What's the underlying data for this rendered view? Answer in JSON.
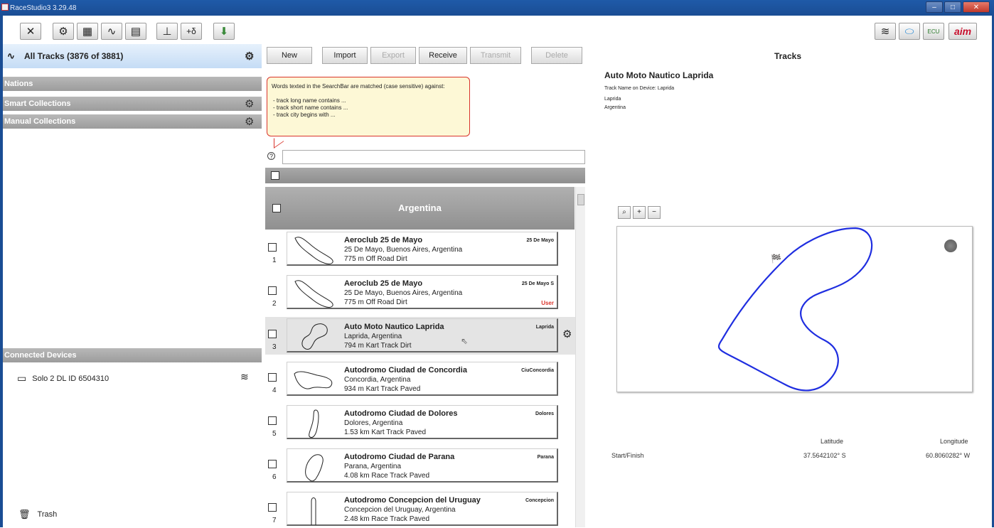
{
  "window": {
    "title": "RaceStudio3 3.29.48"
  },
  "toolbar": {
    "icons": [
      "tools-icon",
      "settings-icon",
      "dashboard-icon",
      "tracks-icon",
      "analysis-icon",
      "tuning-icon",
      "math-channels-icon",
      "download-icon"
    ],
    "right_icons": [
      "wifi-icon",
      "device-icon",
      "ecu-icon",
      "aim-logo"
    ],
    "ecu_label": "ECU",
    "logo_text": "aim"
  },
  "sidebar": {
    "all_tracks": "All Tracks  (3876 of 3881)",
    "sections": [
      "Nations",
      "Smart Collections",
      "Manual Collections"
    ],
    "connected_devices_label": "Connected Devices",
    "device": "Solo 2 DL ID 6504310",
    "trash": "Trash"
  },
  "actions": {
    "new": "New",
    "import": "Import",
    "export": "Export",
    "receive": "Receive",
    "transmit": "Transmit",
    "delete": "Delete"
  },
  "tooltip": {
    "line1": "Words texted in the SearchBar are matched (case sensitive) against:",
    "line2": "- track long name contains ...",
    "line3": "- track short name contains ...",
    "line4": "- track city begins with ..."
  },
  "search": {
    "value": "",
    "help": "?"
  },
  "list": {
    "country": "Argentina",
    "tracks": [
      {
        "num": "1",
        "name": "Aeroclub 25 de Mayo",
        "location": "25 De Mayo, Buenos Aires, Argentina",
        "type": "775 m Off Road Dirt",
        "short": "25 De Mayo",
        "user": ""
      },
      {
        "num": "2",
        "name": "Aeroclub 25 de Mayo",
        "location": "25 De Mayo, Buenos Aires, Argentina",
        "type": "775 m Off Road Dirt",
        "short": "25 De Mayo S",
        "user": "User"
      },
      {
        "num": "3",
        "name": "Auto Moto Nautico Laprida",
        "location": "Laprida, Argentina",
        "type": "794 m Kart Track Dirt",
        "short": "Laprida",
        "user": ""
      },
      {
        "num": "4",
        "name": "Autodromo Ciudad de Concordia",
        "location": "Concordia, Argentina",
        "type": "934 m Kart Track Paved",
        "short": "CiuConcordia",
        "user": ""
      },
      {
        "num": "5",
        "name": "Autodromo Ciudad de Dolores",
        "location": "Dolores, Argentina",
        "type": "1.53 km Kart Track Paved",
        "short": "Dolores",
        "user": ""
      },
      {
        "num": "6",
        "name": "Autodromo Ciudad de Parana",
        "location": "Parana, Argentina",
        "type": "4.08 km Race Track Paved",
        "short": "Parana",
        "user": ""
      },
      {
        "num": "7",
        "name": "Autodromo Concepcion del Uruguay",
        "location": "Concepcion del Uruguay, Argentina",
        "type": "2.48 km Race Track Paved",
        "short": "Concepcion",
        "user": ""
      }
    ]
  },
  "detail": {
    "header": "Tracks",
    "name": "Auto Moto Nautico Laprida",
    "device_name": "Track Name on Device: Laprida",
    "city": "Laprida",
    "country": "Argentina",
    "zoom_buttons": [
      "zoom-fit-icon",
      "zoom-in-icon",
      "zoom-out-icon"
    ],
    "latitude_label": "Latitude",
    "longitude_label": "Longitude",
    "start_finish_label": "Start/Finish",
    "start_lat": "37.5642102° S",
    "start_lon": "60.8060282° W"
  }
}
